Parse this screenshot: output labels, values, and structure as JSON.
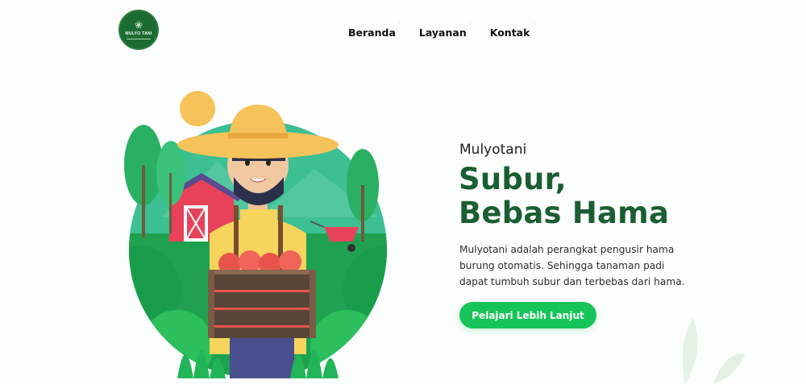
{
  "logo": {
    "text": "MULYO TANI",
    "icon": "leaf-icon"
  },
  "nav": {
    "items": [
      {
        "label": "Beranda"
      },
      {
        "label": "Layanan"
      },
      {
        "label": "Kontak"
      }
    ]
  },
  "hero": {
    "eyebrow": "Mulyotani",
    "headline_line1": "Subur,",
    "headline_line2": "Bebas Hama",
    "description": "Mulyotani adalah perangkat pengusir hama burung otomatis. Sehingga tanaman padi dapat tumbuh subur dan terbebas dari hama.",
    "cta_label": "Pelajari Lebih Lanjut"
  },
  "colors": {
    "brand_green": "#1b5e33",
    "button_green": "#17c45a",
    "background": "#fcfdfd"
  }
}
